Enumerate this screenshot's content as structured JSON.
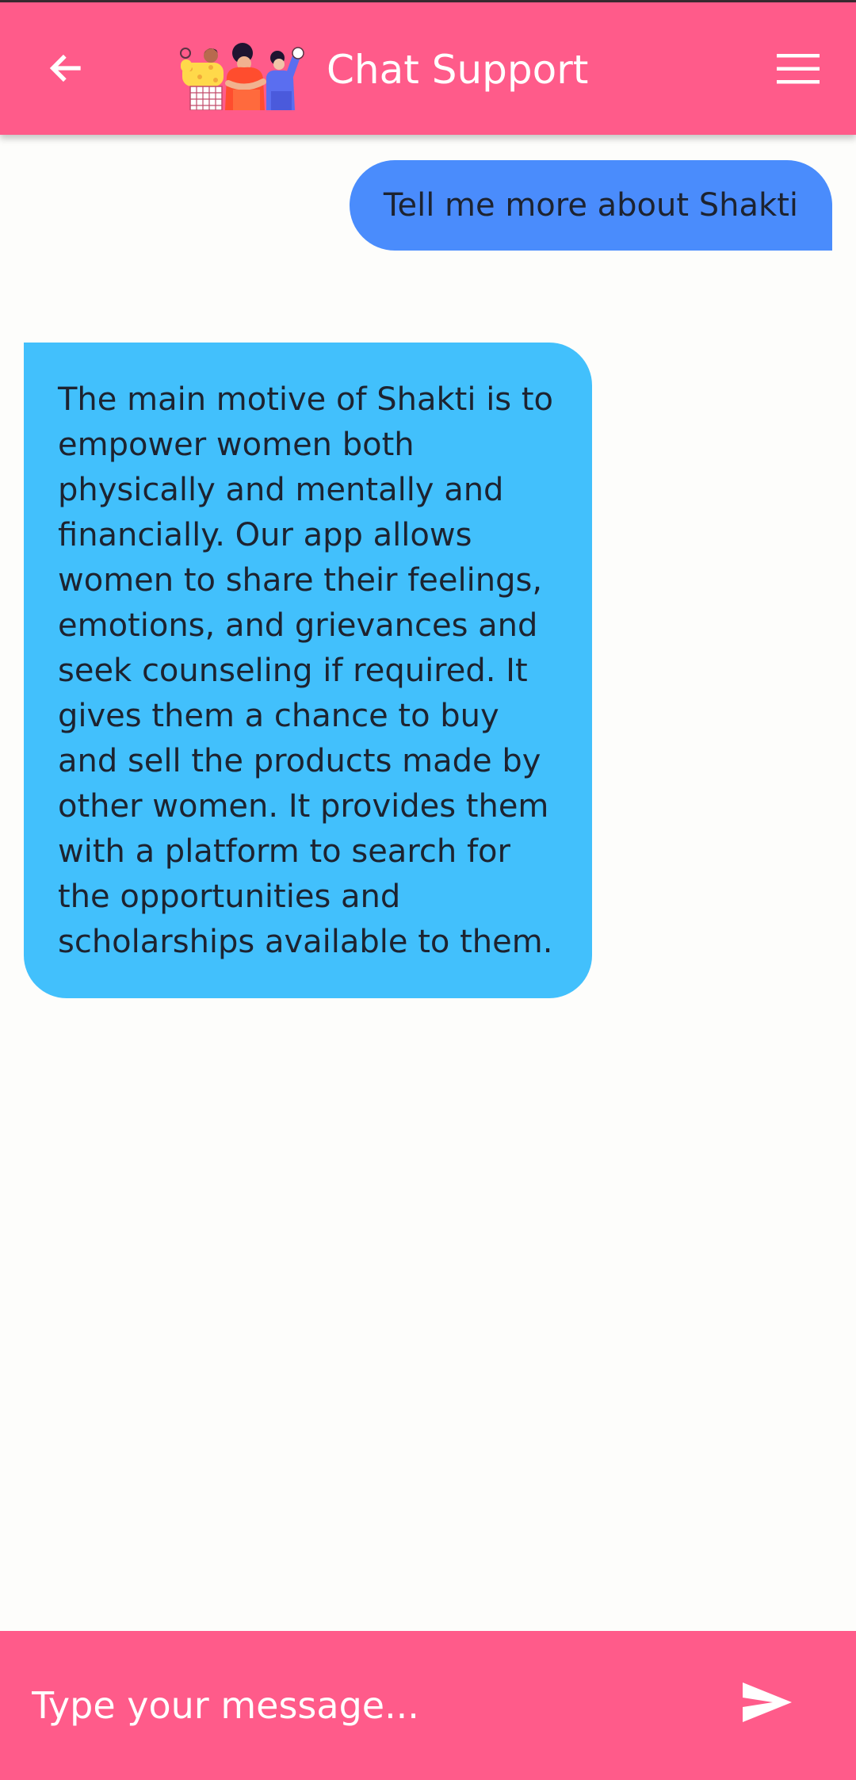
{
  "app_bar": {
    "title": "Chat Support",
    "back_icon": "arrow-left-icon",
    "menu_icon": "hamburger-menu-icon",
    "brand_image": "women-group-illustration",
    "background_color": "#ff5b8a"
  },
  "messages": [
    {
      "sender": "user",
      "text": "Tell me more about Shakti",
      "bubble_color": "#4a8cfc"
    },
    {
      "sender": "bot",
      "text": "The main motive of Shakti is to empower women both physically and mentally and financially. Our app allows women to share their feelings, emotions, and grievances and seek counseling if required. It gives them a chance to buy and sell the products made by other women. It provides them with a platform to search for the opportunities and scholarships available to them.",
      "bubble_color": "#42c0fc"
    }
  ],
  "composer": {
    "value": "",
    "placeholder": "Type your message...",
    "send_icon": "send-icon"
  }
}
